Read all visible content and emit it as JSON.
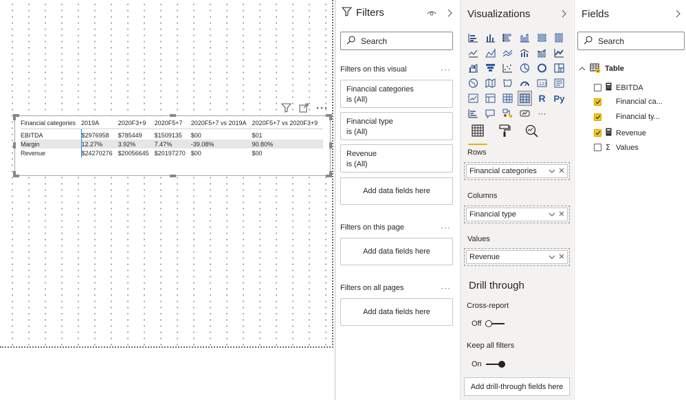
{
  "visual": {
    "columns": [
      "Financial categories",
      "2019A",
      "2020F3+9",
      "2020F5+7",
      "2020F5+7 vs 2019A",
      "2020F5+7 vs 2020F3+9"
    ],
    "rows": [
      {
        "category": "EBITDA",
        "values": [
          "$2976958",
          "$785449",
          "$1509135",
          "$00",
          "$01"
        ]
      },
      {
        "category": "Margin",
        "values": [
          "12.27%",
          "3.92%",
          "7.47%",
          "-39.08%",
          "90.80%"
        ]
      },
      {
        "category": "Revenue",
        "values": [
          "$24270276",
          "$20056645",
          "$20197270",
          "$00",
          "$00"
        ]
      }
    ]
  },
  "filters": {
    "title": "Filters",
    "search_placeholder": "Search",
    "on_visual_label": "Filters on this visual",
    "visual_filters": [
      {
        "name": "Financial categories",
        "state": "is (All)"
      },
      {
        "name": "Financial type",
        "state": "is (All)"
      },
      {
        "name": "Revenue",
        "state": "is (All)"
      }
    ],
    "add_fields_label": "Add data fields here",
    "on_page_label": "Filters on this page",
    "on_all_pages_label": "Filters on all pages",
    "ellipsis": "···"
  },
  "visualizations": {
    "title": "Visualizations",
    "wells": {
      "rows_label": "Rows",
      "rows_value": "Financial categories",
      "columns_label": "Columns",
      "columns_value": "Financial type",
      "values_label": "Values",
      "values_value": "Revenue"
    },
    "drill": {
      "title": "Drill through",
      "cross_report_label": "Cross-report",
      "cross_report_state": "Off",
      "keep_filters_label": "Keep all filters",
      "keep_filters_state": "On",
      "add_label": "Add drill-through fields here"
    },
    "icon_text": {
      "r": "R",
      "py": "Py",
      "more": "···"
    }
  },
  "fields": {
    "title": "Fields",
    "search_placeholder": "Search",
    "table_name": "Table",
    "items": [
      {
        "name": "EBITDA",
        "checked": false,
        "icon": "calculator-icon"
      },
      {
        "name": "Financial ca...",
        "checked": true,
        "icon": ""
      },
      {
        "name": "Financial ty...",
        "checked": true,
        "icon": ""
      },
      {
        "name": "Revenue",
        "checked": true,
        "icon": "calculator-icon"
      },
      {
        "name": "Values",
        "checked": false,
        "icon": "sigma-icon"
      }
    ],
    "sigma": "Σ"
  },
  "colors": {
    "accent_yellow": "#f2c811",
    "selection_blue": "#118dff",
    "pane_gray": "#f3f2f1"
  }
}
